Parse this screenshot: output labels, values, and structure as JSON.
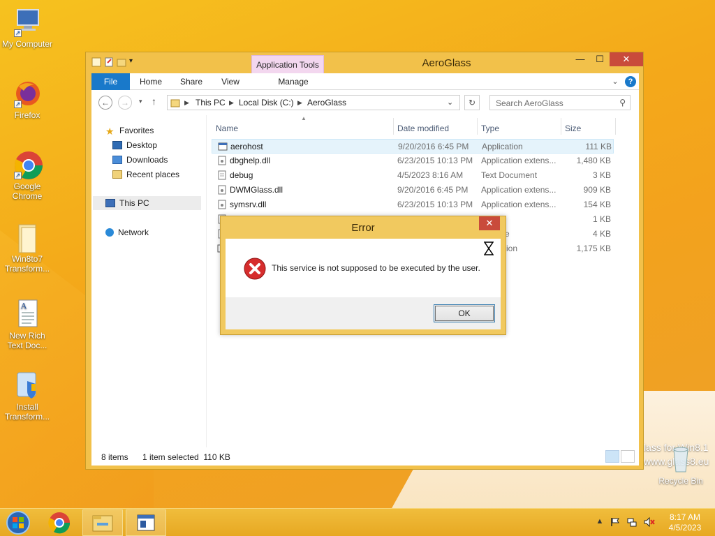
{
  "desktop": {
    "icons": [
      {
        "label_line1": "My Computer",
        "label_line2": ""
      },
      {
        "label_line1": "Firefox",
        "label_line2": ""
      },
      {
        "label_line1": "Google",
        "label_line2": "Chrome"
      },
      {
        "label_line1": "Win8to7",
        "label_line2": "Transform..."
      },
      {
        "label_line1": "New Rich",
        "label_line2": "Text Doc..."
      },
      {
        "label_line1": "Install",
        "label_line2": "Transform..."
      }
    ],
    "recycle_bin": "Recycle Bin",
    "watermark_line1": "lass for Win8.1",
    "watermark_line2": "www.glass8.eu"
  },
  "explorer": {
    "title": "AeroGlass",
    "context_tab_group": "Application Tools",
    "tabs": {
      "file": "File",
      "home": "Home",
      "share": "Share",
      "view": "View",
      "manage": "Manage"
    },
    "caption": {
      "minimize": "—",
      "maximize": "☐",
      "close": "✕"
    },
    "address": {
      "crumbs": [
        "This PC",
        "Local Disk (C:)",
        "AeroGlass"
      ]
    },
    "search_placeholder": "Search AeroGlass",
    "nav": {
      "favorites": "Favorites",
      "desktop": "Desktop",
      "downloads": "Downloads",
      "recent": "Recent places",
      "this_pc": "This PC",
      "network": "Network"
    },
    "columns": {
      "name": "Name",
      "date": "Date modified",
      "type": "Type",
      "size": "Size"
    },
    "files": [
      {
        "name": "aerohost",
        "date": "9/20/2016 6:45 PM",
        "type": "Application",
        "size": "111 KB"
      },
      {
        "name": "dbghelp.dll",
        "date": "6/23/2015 10:13 PM",
        "type": "Application extens...",
        "size": "1,480 KB"
      },
      {
        "name": "debug",
        "date": "4/5/2023 8:16 AM",
        "type": "Text Document",
        "size": "3 KB"
      },
      {
        "name": "DWMGlass.dll",
        "date": "9/20/2016 6:45 PM",
        "type": "Application extens...",
        "size": "909 KB"
      },
      {
        "name": "symsrv.dll",
        "date": "6/23/2015 10:13 PM",
        "type": "Application extens...",
        "size": "154 KB"
      },
      {
        "name": "",
        "date": "",
        "type": "",
        "size": "1 KB"
      },
      {
        "name": "",
        "date": "",
        "type": "e",
        "size": "4 KB"
      },
      {
        "name": "",
        "date": "",
        "type": "ation",
        "size": "1,175 KB"
      }
    ],
    "status": {
      "items": "8 items",
      "selection": "1 item selected  110 KB"
    }
  },
  "dialog": {
    "title": "Error",
    "close": "✕",
    "message": "This service is not supposed to be executed by the user.",
    "ok": "OK"
  },
  "taskbar": {
    "time": "8:17 AM",
    "date": "4/5/2023"
  },
  "colors": {
    "accent": "#1979ca",
    "error_red": "#c94b3b",
    "window_frame": "#f2c14a"
  }
}
